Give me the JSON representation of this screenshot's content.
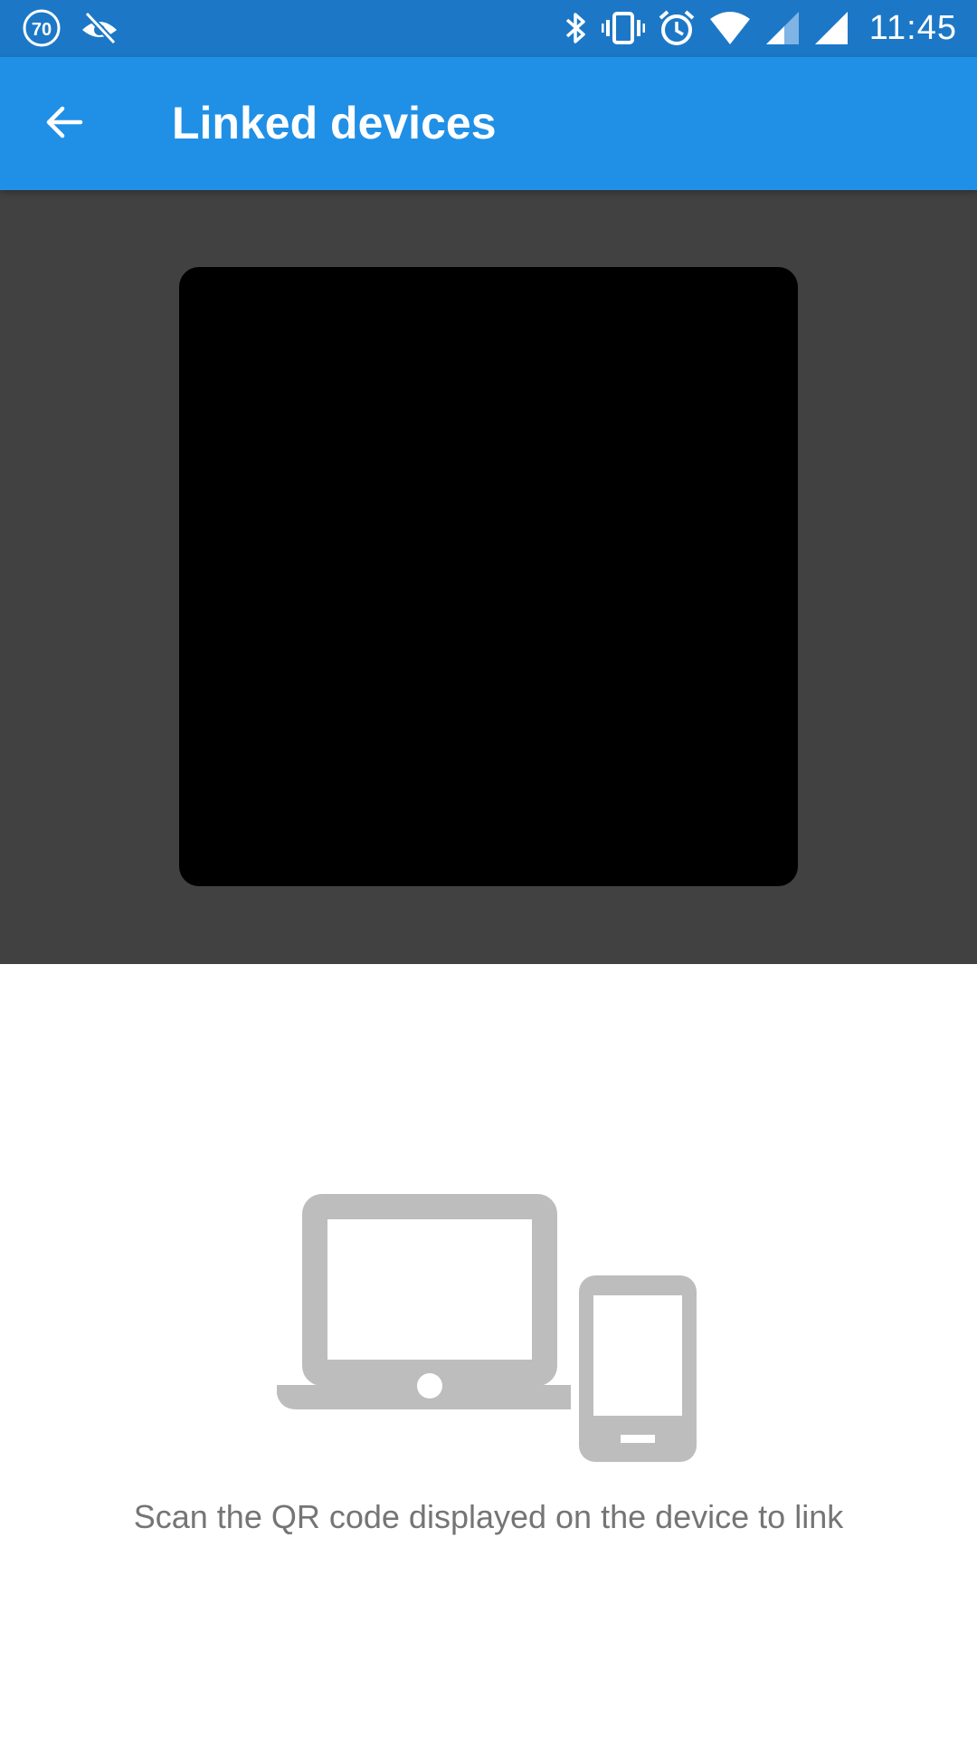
{
  "status_bar": {
    "time": "11:45",
    "notification_badge": "70",
    "icons": [
      "speed-limit-70-icon",
      "eye-off-icon",
      "bluetooth-icon",
      "vibrate-icon",
      "alarm-icon",
      "wifi-icon",
      "cell-signal-icon",
      "cell-signal-full-icon"
    ]
  },
  "app_bar": {
    "title": "Linked devices",
    "back_icon": "arrow-back-icon"
  },
  "scanner": {
    "icon": "qr-scanner-viewfinder"
  },
  "illustration": {
    "icon": "laptop-and-phone-icon"
  },
  "instruction": {
    "text": "Scan the QR code displayed on the device to link"
  },
  "colors": {
    "status_bar": "#1c78c6",
    "app_bar": "#2090e6",
    "scanner_bg": "#414141",
    "viewfinder": "#000000",
    "illustration": "#bdbdbd",
    "instruction_text": "#757575"
  }
}
